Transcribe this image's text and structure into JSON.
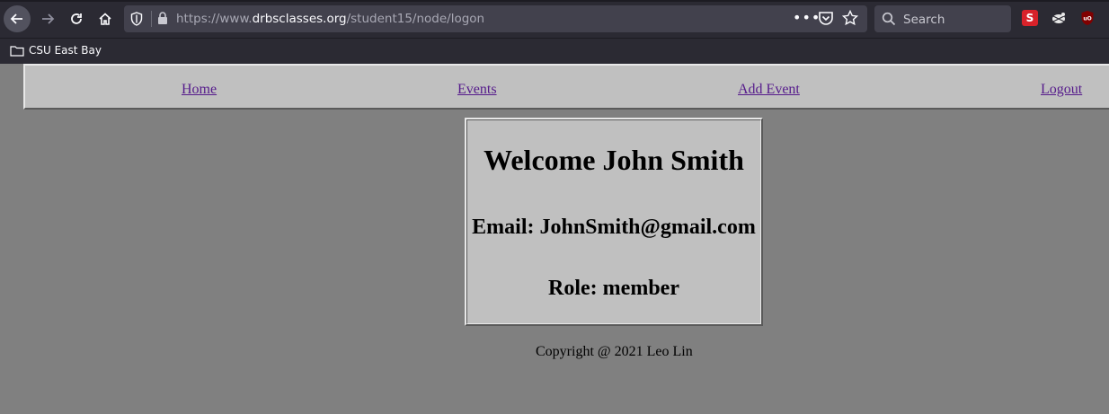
{
  "browser": {
    "url_prefix": "https://www.",
    "url_domain": "drbsclasses.org",
    "url_path": "/student15/node/logon",
    "search_placeholder": "Search",
    "ext_s_label": "S"
  },
  "bookmarks": [
    {
      "label": "CSU East Bay"
    }
  ],
  "nav": {
    "home": "Home",
    "events": "Events",
    "add_event": "Add Event",
    "logout": "Logout"
  },
  "card": {
    "welcome": "Welcome John Smith",
    "email": "Email: JohnSmith@gmail.com",
    "role": "Role: member"
  },
  "footer": {
    "copyright": "Copyright @ 2021 Leo Lin"
  },
  "colors": {
    "page_bg": "#808080",
    "panel_bg": "#c0c0c0",
    "link": "#551a8b",
    "chrome_bg": "#2b2a33"
  }
}
